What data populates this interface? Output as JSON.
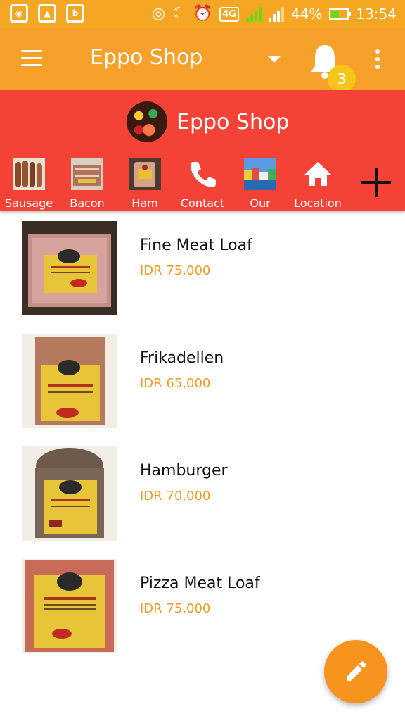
{
  "status_bar": {
    "battery": "44%",
    "time": "13:54",
    "network": "4G",
    "sim1": "1",
    "sim2": "2",
    "battery_level": 0.44
  },
  "toolbar": {
    "title": "Eppo Shop",
    "notification_count": "3"
  },
  "header": {
    "shop_name": "Eppo Shop"
  },
  "categories": [
    {
      "label": "Sausage",
      "icon": "sausage-image"
    },
    {
      "label": "Bacon",
      "icon": "bacon-image"
    },
    {
      "label": "Ham",
      "icon": "ham-image"
    },
    {
      "label": "Contact",
      "icon": "phone-icon"
    },
    {
      "label": "Our",
      "icon": "our-image"
    },
    {
      "label": "Location",
      "icon": "home-icon"
    }
  ],
  "products": [
    {
      "name": "Fine Meat Loaf",
      "price": "IDR 75,000"
    },
    {
      "name": "Frikadellen",
      "price": "IDR 65,000"
    },
    {
      "name": "Hamburger",
      "price": "IDR 70,000"
    },
    {
      "name": "Pizza Meat Loaf",
      "price": "IDR 75,000"
    }
  ],
  "colors": {
    "toolbar": "#f7a02a",
    "header": "#f44336",
    "price": "#f39b1f",
    "fab": "#f7941d",
    "badge": "#f5c518"
  }
}
